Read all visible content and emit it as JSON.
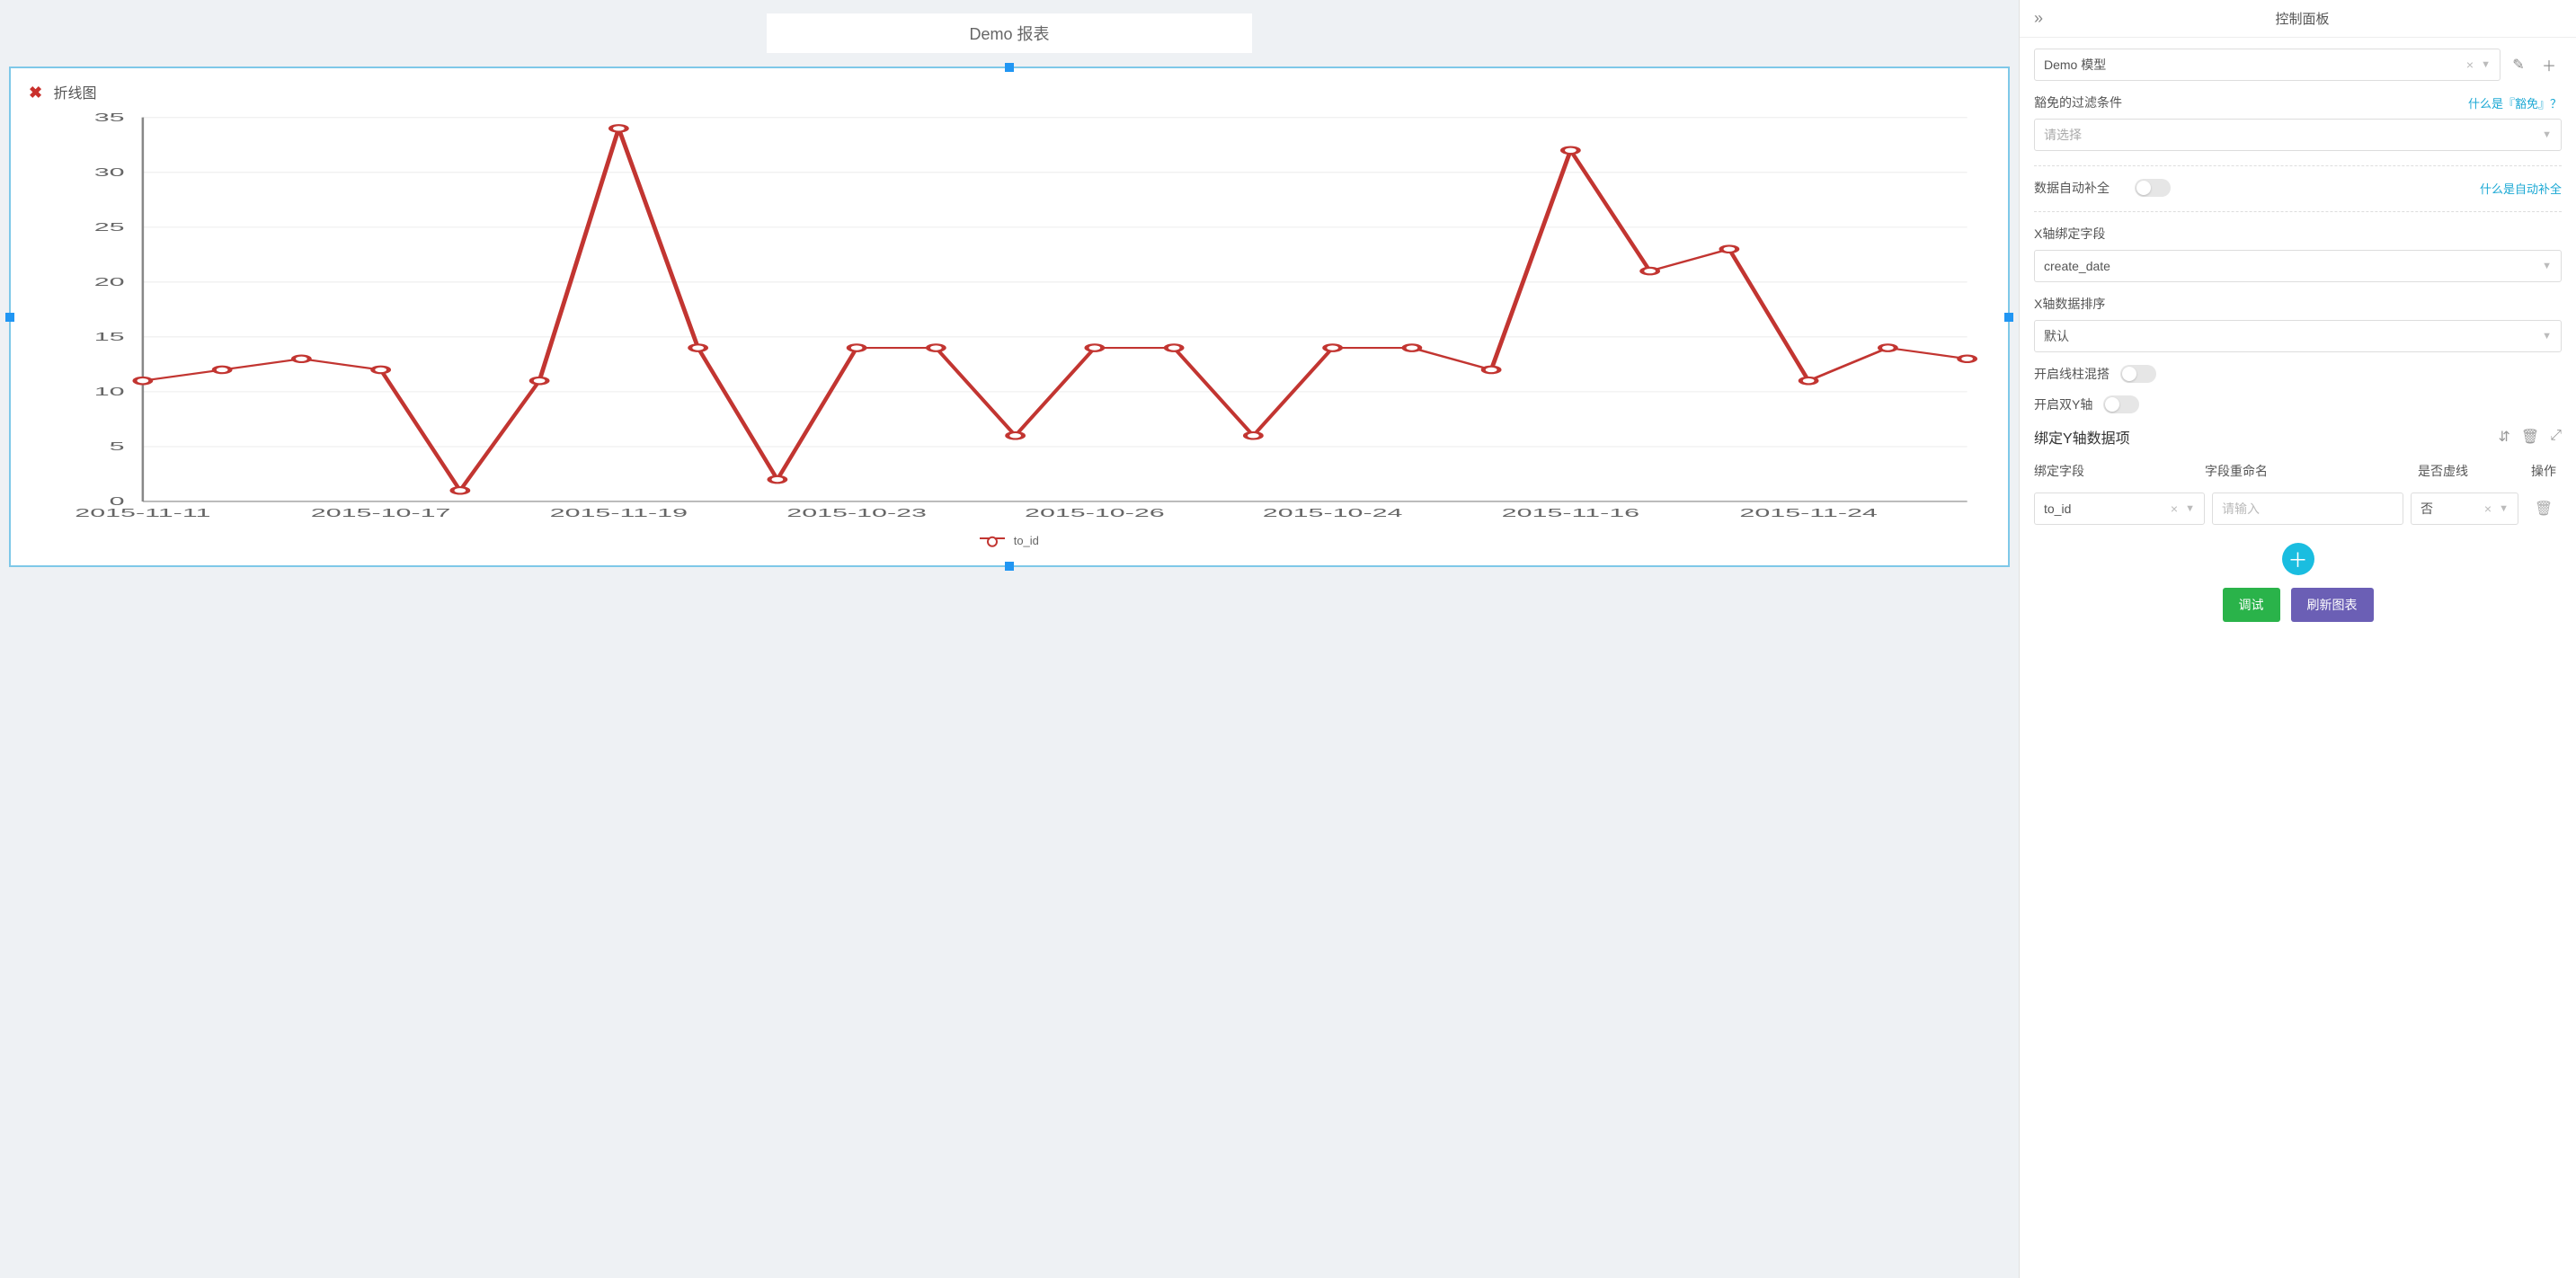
{
  "report": {
    "title": "Demo 报表",
    "chart_title": "折线图",
    "legend": "to_id"
  },
  "panel": {
    "title": "控制面板",
    "model": {
      "value": "Demo 模型"
    },
    "exempt": {
      "label": "豁免的过滤条件",
      "help": "什么是『豁免』？",
      "placeholder": "请选择"
    },
    "autofill": {
      "label": "数据自动补全",
      "help": "什么是自动补全"
    },
    "x_field": {
      "label": "X轴绑定字段",
      "value": "create_date"
    },
    "x_sort": {
      "label": "X轴数据排序",
      "value": "默认"
    },
    "mix_line_bar": {
      "label": "开启线柱混搭"
    },
    "dual_y": {
      "label": "开启双Y轴"
    },
    "y_bind": {
      "label": "绑定Y轴数据项",
      "headers": {
        "field": "绑定字段",
        "rename": "字段重命名",
        "dashed": "是否虚线",
        "ops": "操作"
      },
      "row": {
        "field": "to_id",
        "rename_placeholder": "请输入",
        "dashed": "否"
      }
    },
    "actions": {
      "debug": "调试",
      "refresh": "刷新图表"
    }
  },
  "chart_data": {
    "type": "line",
    "title": "折线图",
    "xlabel": "",
    "ylabel": "",
    "ylim": [
      0,
      35
    ],
    "y_ticks": [
      0,
      5,
      10,
      15,
      20,
      25,
      30,
      35
    ],
    "x_tick_labels": [
      "2015-11-11",
      "2015-10-17",
      "2015-11-19",
      "2015-10-23",
      "2015-10-26",
      "2015-10-24",
      "2015-11-16",
      "2015-11-24"
    ],
    "categories": [
      "2015-11-11",
      "",
      "",
      "2015-10-17",
      "",
      "",
      "2015-11-19",
      "",
      "",
      "2015-10-23",
      "",
      "",
      "2015-10-26",
      "",
      "",
      "2015-10-24",
      "",
      "",
      "2015-11-16",
      "",
      "",
      "2015-11-24",
      ""
    ],
    "series": [
      {
        "name": "to_id",
        "values": [
          11,
          12,
          13,
          12,
          1,
          11,
          34,
          14,
          2,
          14,
          14,
          6,
          14,
          14,
          6,
          14,
          14,
          12,
          32,
          21,
          23,
          11,
          14,
          13
        ]
      }
    ]
  }
}
